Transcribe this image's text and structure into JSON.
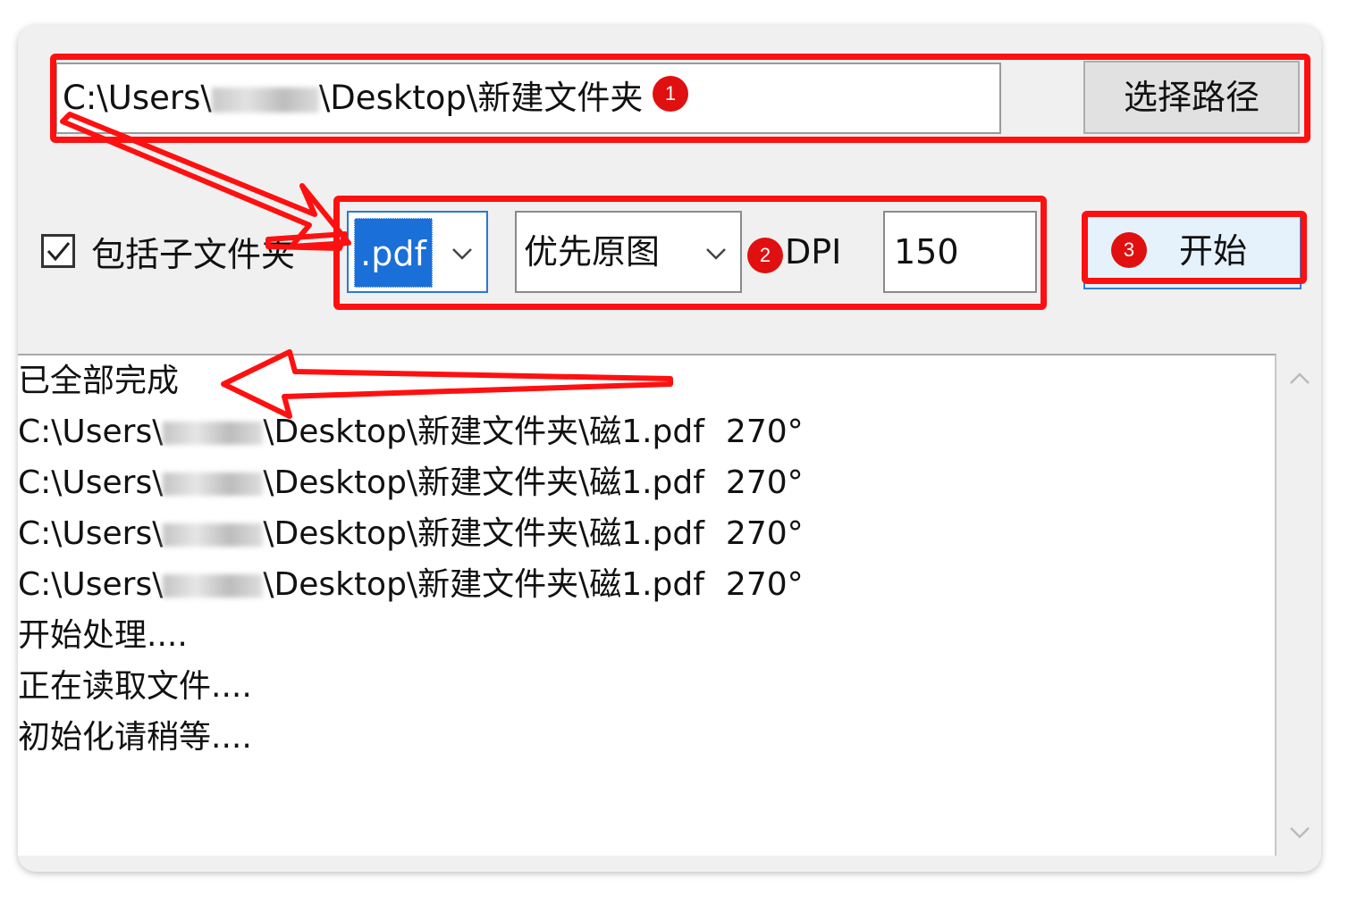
{
  "path": {
    "prefix": "C:\\Users\\",
    "suffix": "\\Desktop\\新建文件夹",
    "browse_label": "选择路径"
  },
  "options": {
    "include_subfolders_label": "包括子文件夹",
    "include_subfolders_checked": true,
    "format_value": ".pdf",
    "mode_value": "优先原图",
    "dpi_label": "DPI",
    "dpi_value": "150",
    "start_label": "开始"
  },
  "log": {
    "lines": [
      {
        "text": "已全部完成"
      },
      {
        "prefix": "C:\\Users\\",
        "suffix": "\\Desktop\\新建文件夹\\磁1.pdf",
        "angle": "270°"
      },
      {
        "prefix": "C:\\Users\\",
        "suffix": "\\Desktop\\新建文件夹\\磁1.pdf",
        "angle": "270°"
      },
      {
        "prefix": "C:\\Users\\",
        "suffix": "\\Desktop\\新建文件夹\\磁1.pdf",
        "angle": "270°"
      },
      {
        "prefix": "C:\\Users\\",
        "suffix": "\\Desktop\\新建文件夹\\磁1.pdf",
        "angle": "270°"
      },
      {
        "text": "开始处理...."
      },
      {
        "text": "正在读取文件...."
      },
      {
        "text": "初始化请稍等...."
      }
    ]
  },
  "annotations": {
    "badge1": "1",
    "badge2": "2",
    "badge3": "3",
    "color": "#ff1010"
  },
  "icons": [
    "checkmark-icon",
    "chevron-down-icon",
    "chevron-up-icon"
  ]
}
